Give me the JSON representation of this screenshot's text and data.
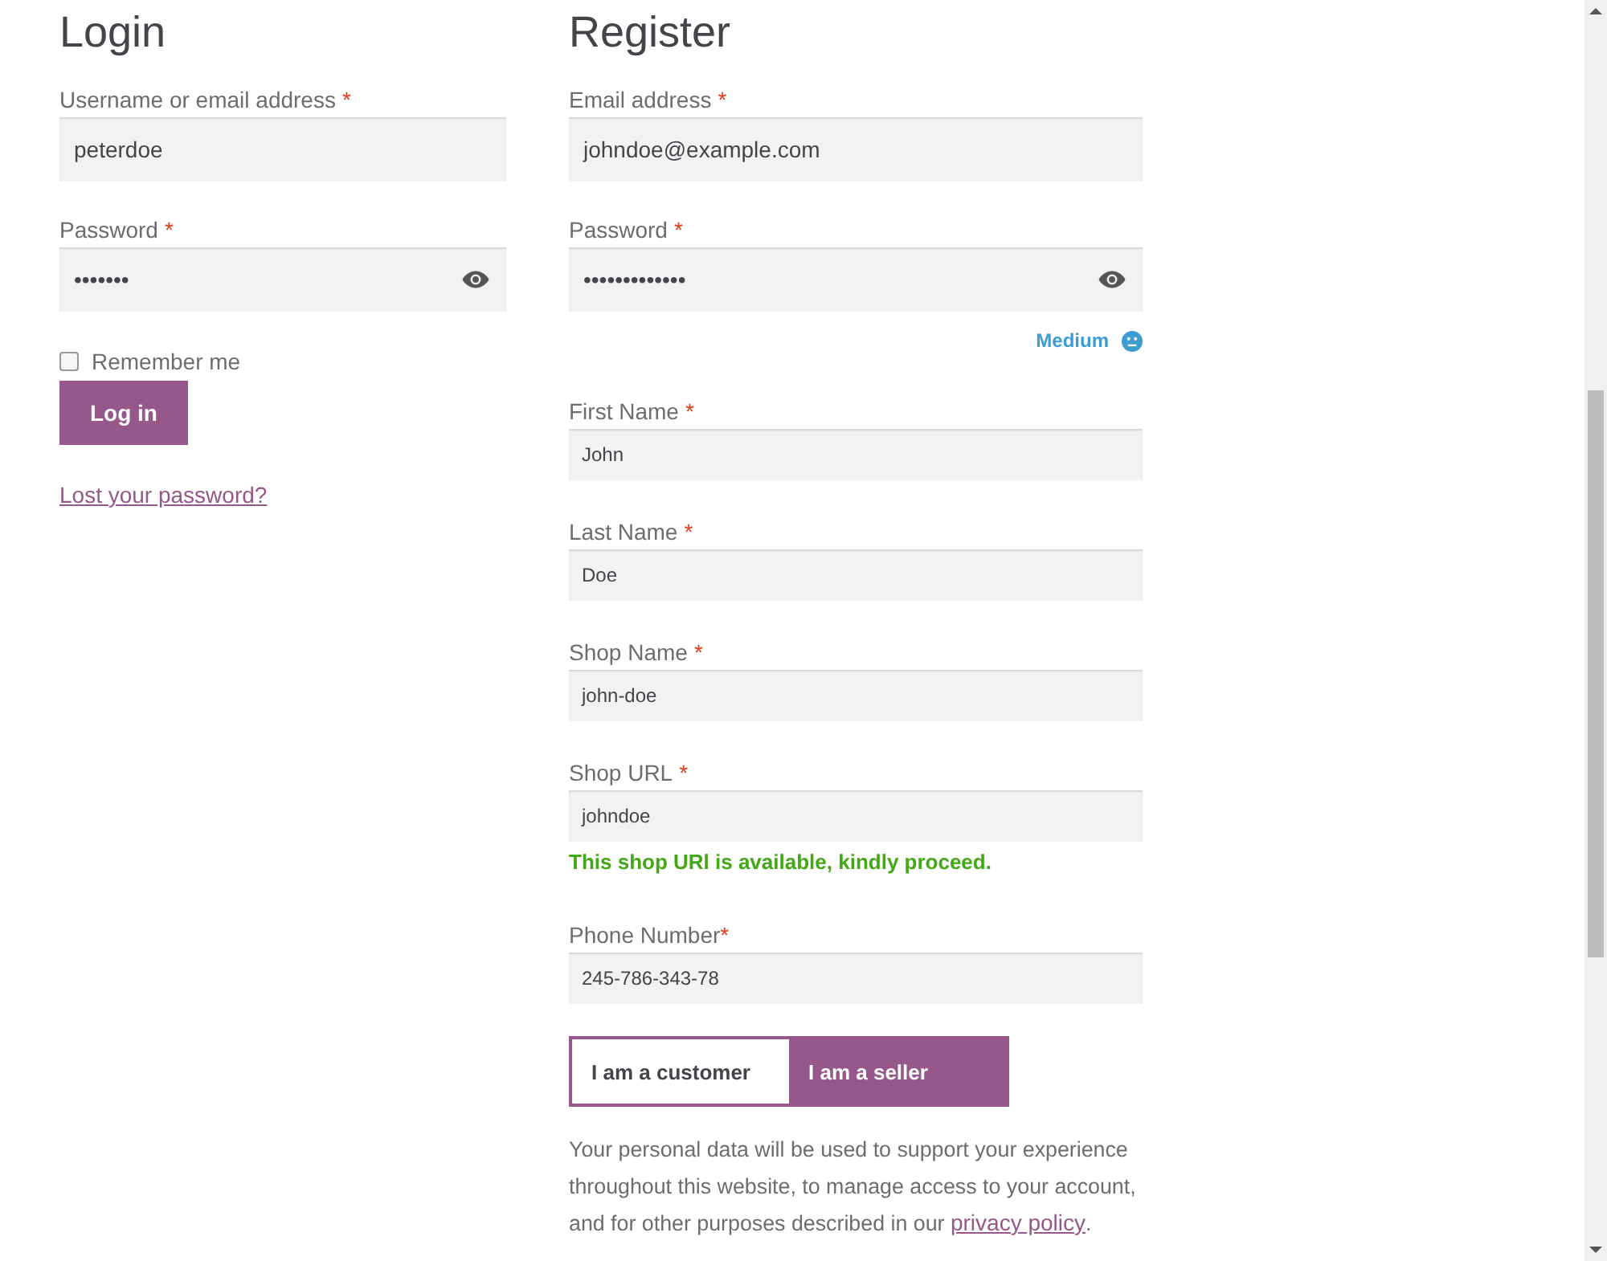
{
  "login": {
    "title": "Login",
    "fields": [
      {
        "kind": "text",
        "label": "Username or email address",
        "mark": "*",
        "value": "peterdoe"
      },
      {
        "kind": "password",
        "label": "Password",
        "mark": "*",
        "value": "•••••••"
      }
    ],
    "remember": {
      "label": "Remember me",
      "checked": false
    },
    "button": "Log in",
    "lost_link": "Lost your password?"
  },
  "register": {
    "title": "Register",
    "fields": [
      {
        "kind": "text",
        "label": "Email address",
        "mark": "*",
        "value": "johndoe@example.com"
      },
      {
        "kind": "password",
        "label": "Password",
        "mark": "*",
        "value": "•••••••••••••",
        "strength": "Medium"
      }
    ],
    "extra_fields": [
      {
        "label": "First Name",
        "mark": "*",
        "value": "John"
      },
      {
        "label": "Last Name",
        "mark": "*",
        "value": "Doe"
      },
      {
        "label": "Shop Name",
        "mark": "*",
        "value": "john-doe"
      },
      {
        "label": "Shop URL",
        "mark": "*",
        "value": "johndoe",
        "message": "This shop URl is available, kindly proceed."
      },
      {
        "label": "Phone Number",
        "mark": "*",
        "mark_gap": false,
        "value": "245-786-343-78"
      }
    ],
    "roles": [
      {
        "label": "I am a customer",
        "selected": false
      },
      {
        "label": "I am a seller",
        "selected": true
      }
    ],
    "privacy": {
      "before": "Your personal data will be used to support your experience throughout this website, to manage access to your account, and for other purposes described in our ",
      "link": "privacy policy",
      "after": "."
    }
  }
}
